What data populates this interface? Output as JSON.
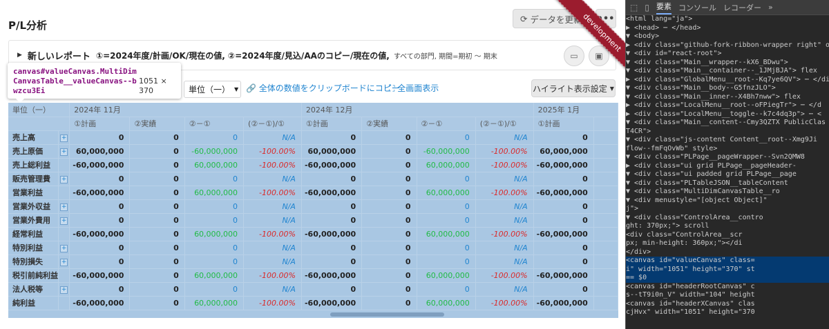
{
  "page": {
    "title": "P/L分析",
    "refresh_label": "データを更新",
    "more_label": "•••"
  },
  "report": {
    "name": "新しいレポート",
    "description": "①=2024年度/計画/OK/現在の値, ②=2024年度/見込/AAのコピー/現在の値,",
    "scope": "すべての部門, 期間=期初 〜 期末"
  },
  "tooltip": {
    "selector": "canvas#valueCanvas.MultiDimCanvasTable__valueCanvas--bwzcu3Ei",
    "size": "1051 × 370"
  },
  "toolbar": {
    "unit_label": "単位（一）",
    "copy_label": "全体の数値をクリップボードにコピー",
    "fullscreen_label": "全画面表示",
    "highlight_label": "ハイライト表示設定"
  },
  "ribbon": {
    "text": "development"
  },
  "table": {
    "corner": "単位（一）",
    "months": [
      "2024年 11月",
      "2024年 12月",
      "2025年 1月"
    ],
    "subcolumns": [
      "①計画",
      "②実績",
      "②－①",
      "(②－①)/①"
    ],
    "rows": [
      {
        "label": "売上高",
        "expandable": true,
        "values": [
          "0",
          "0",
          "0",
          "N/A"
        ]
      },
      {
        "label": "売上原価",
        "expandable": true,
        "values": [
          "60,000,000",
          "0",
          "-60,000,000",
          "-100.00%"
        ]
      },
      {
        "label": "売上総利益",
        "expandable": false,
        "values": [
          "-60,000,000",
          "0",
          "60,000,000",
          "-100.00%"
        ]
      },
      {
        "label": "販売管理費",
        "expandable": true,
        "values": [
          "0",
          "0",
          "0",
          "N/A"
        ]
      },
      {
        "label": "営業利益",
        "expandable": false,
        "values": [
          "-60,000,000",
          "0",
          "60,000,000",
          "-100.00%"
        ]
      },
      {
        "label": "営業外収益",
        "expandable": true,
        "values": [
          "0",
          "0",
          "0",
          "N/A"
        ]
      },
      {
        "label": "営業外費用",
        "expandable": true,
        "values": [
          "0",
          "0",
          "0",
          "N/A"
        ]
      },
      {
        "label": "経常利益",
        "expandable": false,
        "values": [
          "-60,000,000",
          "0",
          "60,000,000",
          "-100.00%"
        ]
      },
      {
        "label": "特別利益",
        "expandable": true,
        "values": [
          "0",
          "0",
          "0",
          "N/A"
        ]
      },
      {
        "label": "特別損失",
        "expandable": true,
        "values": [
          "0",
          "0",
          "0",
          "N/A"
        ]
      },
      {
        "label": "税引前純利益",
        "expandable": false,
        "values": [
          "-60,000,000",
          "0",
          "60,000,000",
          "-100.00%"
        ]
      },
      {
        "label": "法人税等",
        "expandable": true,
        "values": [
          "0",
          "0",
          "0",
          "N/A"
        ]
      },
      {
        "label": "純利益",
        "expandable": false,
        "values": [
          "-60,000,000",
          "0",
          "60,000,000",
          "-100.00%"
        ]
      }
    ]
  },
  "devtools": {
    "tabs": [
      "要素",
      "コンソール",
      "レコーダー"
    ],
    "lines": [
      {
        "t": "<html lang=\"ja\">",
        "sel": false
      },
      {
        "t": " ▶ <head> ⋯ </head>",
        "sel": false
      },
      {
        "t": " ▼ <body>",
        "sel": false
      },
      {
        "t": "   ▶ <div class=\"github-fork-ribbon-wrapper right\" onclick=\"th",
        "sel": false
      },
      {
        "t": "   ▼ <div id=\"react-root\">",
        "sel": false
      },
      {
        "t": "     ▼ <div class=\"Main__wrapper--kX6_BDwu\">",
        "sel": false
      },
      {
        "t": "       ▼ <div class=\"Main__container--_1JMjBJA\"> flex",
        "sel": false
      },
      {
        "t": "         ▶ <div class=\"GlobalMenu__root--Kq7ye6QV\"> ⋯ </div>",
        "sel": false
      },
      {
        "t": "         ▼ <div class=\"Main__body--G5fnzJLO\">",
        "sel": false
      },
      {
        "t": "           ▼ <div class=\"Main__inner--X4Bh7nww\"> flex",
        "sel": false
      },
      {
        "t": "             ▶ <div class=\"LocalMenu__root--oFPiegTr\"> ⋯ </d",
        "sel": false
      },
      {
        "t": "             ▶ <div class=\"LocalMenu__toggle--k7c4dq3p\"> ⋯ <",
        "sel": false
      },
      {
        "t": "             ▼ <div class=\"Main__content--Cmy3QZTX PublicClas",
        "sel": false
      },
      {
        "t": "               T4CR\">",
        "sel": false
      },
      {
        "t": "               ▼ <div class=\"js-content Content__root--Xmg9Ji",
        "sel": false
      },
      {
        "t": "                 flow--fmFqOvWb\" style>",
        "sel": false
      },
      {
        "t": "                 ▼ <div class=\"PLPage__pageWrapper--Svn2QMW8",
        "sel": false
      },
      {
        "t": "                   ▶ <div class=\"ui grid PLPage__pageHeader-",
        "sel": false
      },
      {
        "t": "                   ▼ <div class=\"ui padded grid PLPage__page",
        "sel": false
      },
      {
        "t": "                     ▼ <div class=\"PLTableJSON__tableContent",
        "sel": false
      },
      {
        "t": "                       ▼ <div class=\"MultiDimCanvasTable__ro",
        "sel": false
      },
      {
        "t": "                         ▼ <div menustyle=\"[object Object]\"",
        "sel": false
      },
      {
        "t": "                           j\">",
        "sel": false
      },
      {
        "t": "                           ▼ <div class=\"ControlArea__contro",
        "sel": false
      },
      {
        "t": "                             ght: 370px;\"> scroll",
        "sel": false
      },
      {
        "t": "                               <div class=\"ControlArea__scr",
        "sel": false
      },
      {
        "t": "                               px; min-height: 360px;\"></di",
        "sel": false
      },
      {
        "t": "                             </div>",
        "sel": false
      },
      {
        "t": "                             <canvas id=\"valueCanvas\" class=",
        "sel": true
      },
      {
        "t": "                             i\" width=\"1051\" height=\"370\" st",
        "sel": true
      },
      {
        "t": "                             == $0",
        "sel": true
      },
      {
        "t": "                             <canvas id=\"headerRootCanvas\" c",
        "sel": false
      },
      {
        "t": "                             s--tT9i0n_V\" width=\"104\" height",
        "sel": false
      },
      {
        "t": "                             <canvas id=\"headerXCanvas\" clas",
        "sel": false
      },
      {
        "t": "                             cjHvx\" width=\"1051\" height=\"370",
        "sel": false
      }
    ]
  }
}
